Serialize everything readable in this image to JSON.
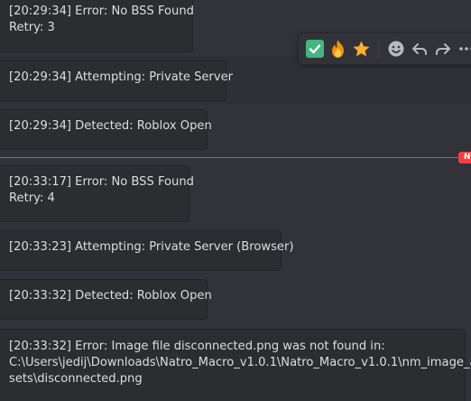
{
  "messages": [
    {
      "lines": [
        "[20:29:34] Error: No BSS Found",
        "Retry: 3"
      ]
    },
    {
      "lines": [
        "[20:29:34] Attempting: Private Server"
      ]
    },
    {
      "lines": [
        "[20:29:34] Detected: Roblox Open"
      ]
    },
    {
      "lines": [
        "[20:33:17] Error: No BSS Found",
        "Retry: 4"
      ]
    },
    {
      "lines": [
        "[20:33:23] Attempting: Private Server (Browser)"
      ]
    },
    {
      "lines": [
        "[20:33:32] Detected: Roblox Open"
      ]
    },
    {
      "lines": [
        "[20:33:32] Error: Image file disconnected.png was not found in:",
        "C:\\Users\\jedij\\Downloads\\Natro_Macro_v1.0.1\\Natro_Macro_v1.0.1\\nm_image_as",
        "sets\\disconnected.png"
      ]
    }
  ],
  "new_divider": {
    "badge_label": "N",
    "color": "#f23f43"
  },
  "toolbar": {
    "reactions": [
      {
        "icon": "check-mark-emoji-icon"
      },
      {
        "icon": "fire-emoji-icon"
      },
      {
        "icon": "star-emoji-icon"
      }
    ],
    "actions": [
      {
        "icon": "add-reaction-icon"
      },
      {
        "icon": "reply-icon"
      },
      {
        "icon": "forward-icon"
      },
      {
        "icon": "more-icon"
      }
    ]
  },
  "colors": {
    "background": "#313338",
    "card": "#2b2d31",
    "text": "#dbdee1",
    "new_accent": "#f23f43"
  }
}
